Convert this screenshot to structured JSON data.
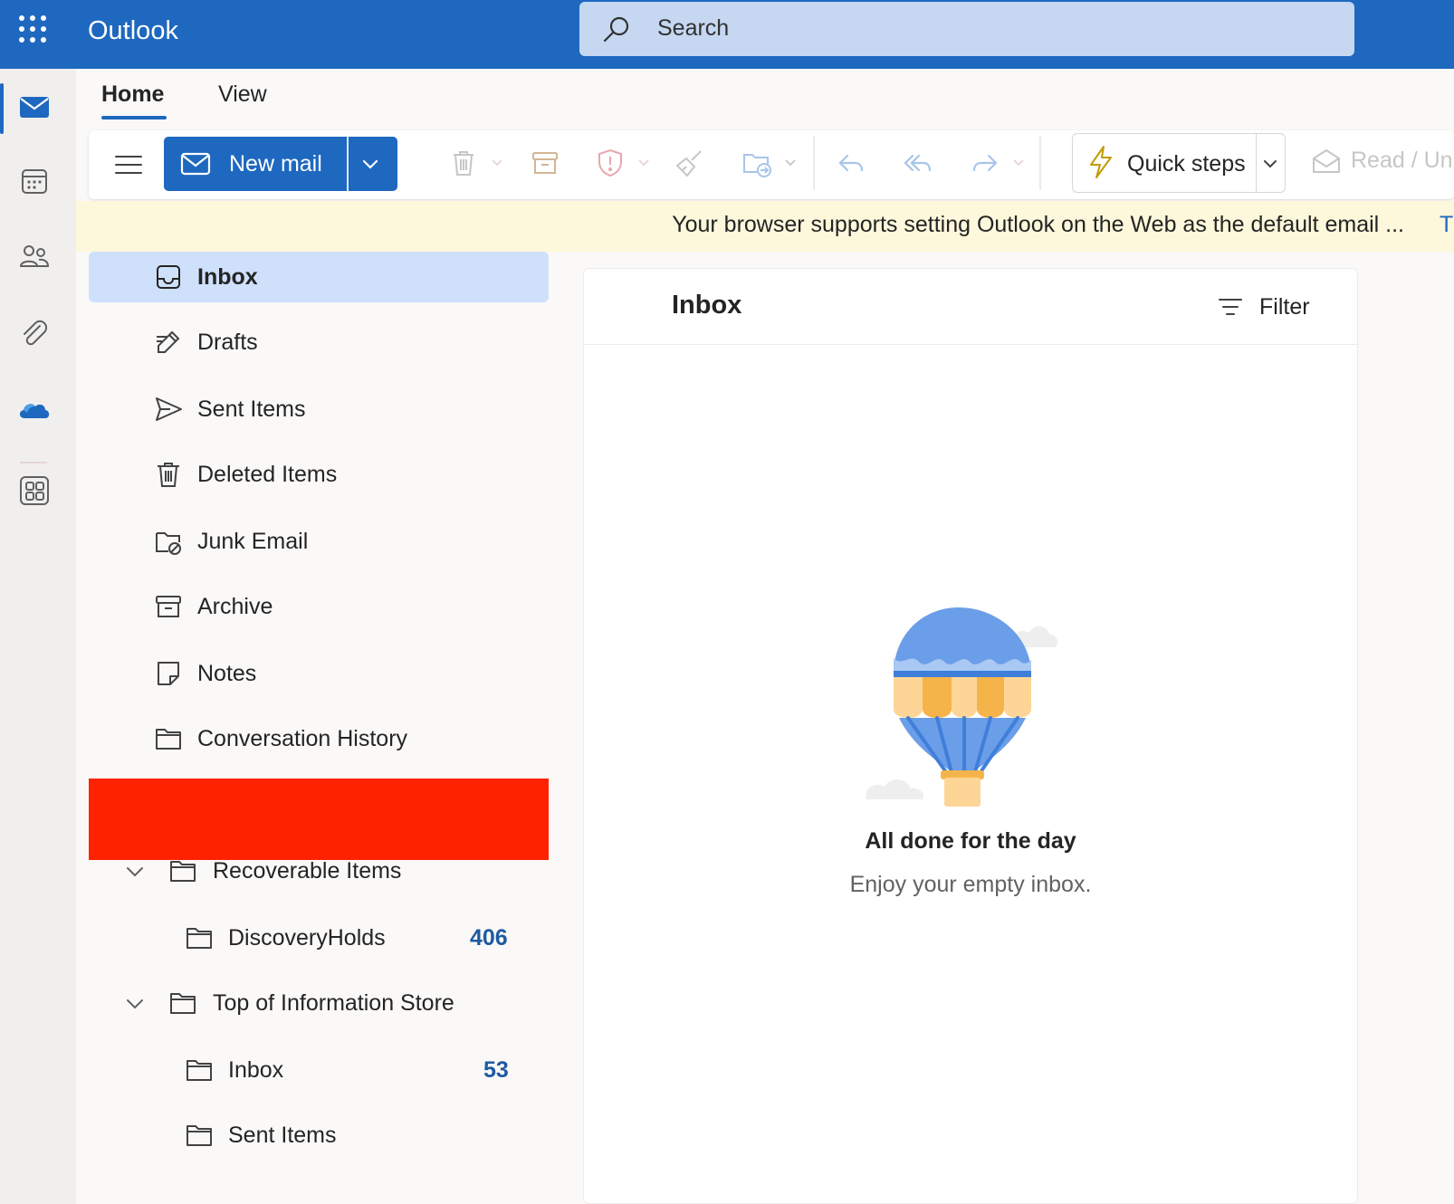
{
  "app": {
    "title": "Outlook"
  },
  "search": {
    "placeholder": "Search"
  },
  "rail": {
    "items": [
      "mail-icon",
      "calendar-icon",
      "people-icon",
      "attachment-icon",
      "onedrive-icon",
      "apps-icon"
    ]
  },
  "tabs": [
    {
      "label": "Home",
      "selected": true
    },
    {
      "label": "View",
      "selected": false
    }
  ],
  "ribbon": {
    "new_mail_label": "New mail",
    "quick_steps_label": "Quick steps",
    "read_unread_label": "Read / Un"
  },
  "banner": {
    "text": "Your browser supports setting Outlook on the Web as the default email ...",
    "link": "Tr"
  },
  "folders": [
    {
      "label": "Inbox",
      "icon": "inbox-icon",
      "selected": true
    },
    {
      "label": "Drafts",
      "icon": "drafts-icon"
    },
    {
      "label": "Sent Items",
      "icon": "send-icon"
    },
    {
      "label": "Deleted Items",
      "icon": "trash-icon"
    },
    {
      "label": "Junk Email",
      "icon": "junk-icon"
    },
    {
      "label": "Archive",
      "icon": "archive-icon"
    },
    {
      "label": "Notes",
      "icon": "notes-icon"
    },
    {
      "label": "Conversation History",
      "icon": "folder-icon"
    }
  ],
  "subfolders": [
    {
      "label": "Recoverable Items",
      "expanded": true,
      "level": 1
    },
    {
      "label": "DiscoveryHolds",
      "count": "406",
      "level": 2
    },
    {
      "label": "Top of Information Store",
      "expanded": true,
      "level": 1
    },
    {
      "label": "Inbox",
      "count": "53",
      "level": 2
    },
    {
      "label": "Sent Items",
      "level": 2
    }
  ],
  "message_list": {
    "title": "Inbox",
    "filter_label": "Filter",
    "empty_title": "All done for the day",
    "empty_subtitle": "Enjoy your empty inbox."
  },
  "colors": {
    "brand": "#1e68bf",
    "selected": "#cfe0fb",
    "banner": "#fdf8db",
    "redaction": "#ff2200"
  }
}
